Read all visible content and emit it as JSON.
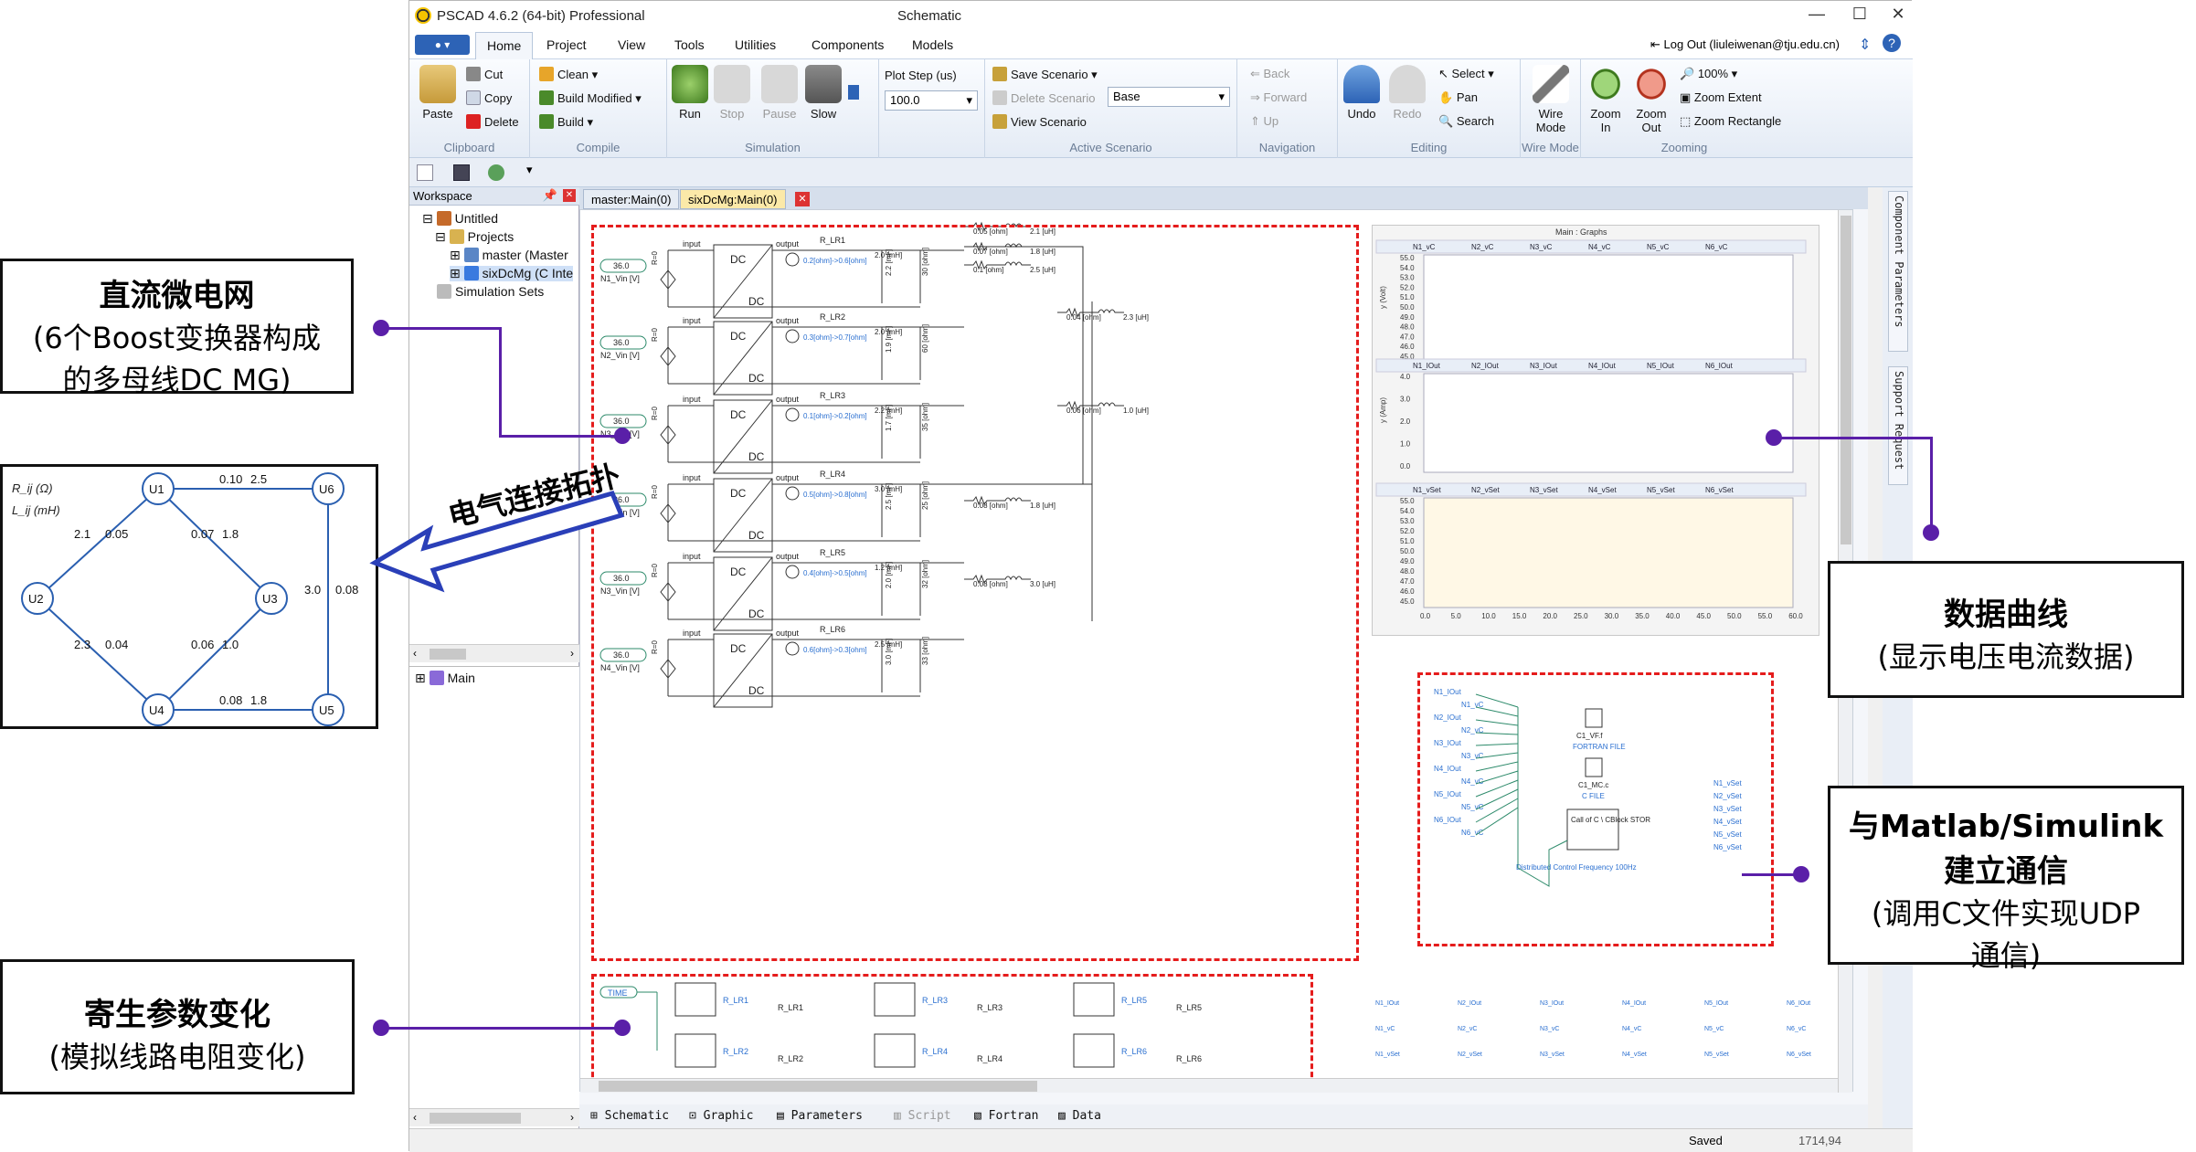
{
  "window": {
    "title": "PSCAD 4.6.2 (64-bit) Professional",
    "context": "Schematic",
    "logout": "Log Out (liuleiwenan@tju.edu.cn)",
    "controls": {
      "minimize": "—",
      "maximize": "☐",
      "close": "✕"
    }
  },
  "ribbon_tabs": [
    "Home",
    "Project",
    "View",
    "Tools",
    "Utilities",
    "Components",
    "Models"
  ],
  "ribbon": {
    "clipboard": {
      "paste": "Paste",
      "cut": "Cut",
      "copy": "Copy",
      "delete": "Delete",
      "label": "Clipboard"
    },
    "compile": {
      "clean": "Clean ▾",
      "build_modified": "Build Modified ▾",
      "build": "Build ▾",
      "label": "Compile"
    },
    "simulation": {
      "run": "Run",
      "stop": "Stop",
      "pause": "Pause",
      "slow": "Slow",
      "plot_step_label": "Plot Step (us)",
      "plot_step_value": "100.0",
      "label": "Simulation"
    },
    "scenario": {
      "save": "Save Scenario ▾",
      "delete": "Delete Scenario",
      "view": "View Scenario",
      "base": "Base",
      "label": "Active Scenario"
    },
    "navigation": {
      "back": "Back",
      "forward": "Forward",
      "up": "Up",
      "label": "Navigation"
    },
    "editing": {
      "undo": "Undo",
      "redo": "Redo",
      "select": "Select ▾",
      "pan": "Pan",
      "search": "Search",
      "label": "Editing"
    },
    "wire": {
      "wire_mode": "Wire Mode",
      "label": "Wire Mode"
    },
    "zooming": {
      "zoom_in": "Zoom In",
      "zoom_out": "Zoom Out",
      "zoom_pct": "100% ▾",
      "zoom_extent": "Zoom Extent",
      "zoom_rect": "Zoom Rectangle",
      "label": "Zooming"
    }
  },
  "workspace": {
    "title": "Workspace",
    "items": [
      "Untitled",
      "Projects",
      "master (Master",
      "sixDcMg (C Inte",
      "Simulation Sets"
    ],
    "bottom_item": "Main"
  },
  "doc_tabs": [
    "master:Main(0)",
    "sixDcMg:Main(0)"
  ],
  "bottom_tabs": [
    "Schematic",
    "Graphic",
    "Parameters",
    "Script",
    "Fortran",
    "Data"
  ],
  "status": {
    "left": "Saved",
    "right": "1714,94"
  },
  "side_tabs": [
    "Component Parameters",
    "Support Request"
  ],
  "schematic": {
    "converters": [
      {
        "src": "N1_Vin [V]",
        "lr": "R_LR1",
        "range": "0.2[ohm]->0.6[ohm]",
        "l": "2.0 [mH]",
        "c": "2.2 [mF]",
        "r": "30 [ohm]"
      },
      {
        "src": "N2_Vin [V]",
        "lr": "R_LR2",
        "range": "0.3[ohm]->0.7[ohm]",
        "l": "2.0 [mH]",
        "c": "1.9 [mF]",
        "r": "60 [ohm]"
      },
      {
        "src": "N3_Vin [V]",
        "lr": "R_LR3",
        "range": "0.1[ohm]->0.2[ohm]",
        "l": "2.2 [mH]",
        "c": "1.7 [mF]",
        "r": "35 [ohm]"
      },
      {
        "src": "N4_Vin [V]",
        "lr": "R_LR4",
        "range": "0.5[ohm]->0.8[ohm]",
        "l": "3.0 [mH]",
        "c": "2.5 [mF]",
        "r": "25 [ohm]"
      },
      {
        "src": "N3_Vin [V]",
        "lr": "R_LR5",
        "range": "0.4[ohm]->0.5[ohm]",
        "l": "1.2 [mH]",
        "c": "2.0 [mF]",
        "r": "32 [ohm]"
      },
      {
        "src": "N4_Vin [V]",
        "lr": "R_LR6",
        "range": "0.6[ohm]->0.3[ohm]",
        "l": "2.5 [mH]",
        "c": "3.0 [mF]",
        "r": "33 [ohm]"
      }
    ],
    "vin": "36.0",
    "rdrop": "R=0",
    "dc": "DC",
    "input": "input",
    "output": "output",
    "lines": [
      {
        "r": "0.05 [ohm]",
        "l": "2.1 [uH]"
      },
      {
        "r": "0.07 [ohm]",
        "l": "1.8 [uH]"
      },
      {
        "r": "0.1 [ohm]",
        "l": "2.5 [uH]"
      },
      {
        "r": "0.04 [ohm]",
        "l": "2.3 [uH]"
      },
      {
        "r": "0.06 [ohm]",
        "l": "1.0 [uH]"
      },
      {
        "r": "0.08 [ohm]",
        "l": "1.8 [uH]"
      },
      {
        "r": "0.08 [ohm]",
        "l": "3.0 [uH]"
      }
    ],
    "graphs": {
      "title": "Main : Graphs",
      "g1": {
        "series": [
          "N1_vC",
          "N2_vC",
          "N3_vC",
          "N4_vC",
          "N5_vC",
          "N6_vC"
        ],
        "ylabel": "y (Volt)",
        "ticks": [
          "55.0",
          "54.0",
          "53.0",
          "52.0",
          "51.0",
          "50.0",
          "49.0",
          "48.0",
          "47.0",
          "46.0",
          "45.0"
        ]
      },
      "g2": {
        "series": [
          "N1_IOut",
          "N2_IOut",
          "N3_IOut",
          "N4_IOut",
          "N5_IOut",
          "N6_IOut"
        ],
        "ylabel": "y (Amp)",
        "ticks": [
          "4.0",
          "3.0",
          "2.0",
          "1.0",
          "0.0"
        ]
      },
      "g3": {
        "series": [
          "N1_vSet",
          "N2_vSet",
          "N3_vSet",
          "N4_vSet",
          "N5_vSet",
          "N6_vSet"
        ],
        "ticks": [
          "55.0",
          "54.0",
          "53.0",
          "52.0",
          "51.0",
          "50.0",
          "49.0",
          "48.0",
          "47.0",
          "46.0",
          "45.0"
        ]
      },
      "xticks": [
        "0.0",
        "5.0",
        "10.0",
        "15.0",
        "20.0",
        "25.0",
        "30.0",
        "35.0",
        "40.0",
        "45.0",
        "50.0",
        "55.0",
        "60.0"
      ]
    },
    "comm": {
      "file1": "C1_VF.f",
      "file1_type": "FORTRAN FILE",
      "file2": "C1_MC.c",
      "file2_type": "C FILE",
      "block": "Call of C \\ CBlock STOR",
      "freq": "Distributed Control Frequency 100Hz",
      "inputs": [
        "N1_IOut",
        "N1_vC",
        "N2_IOut",
        "N2_vC",
        "N3_IOut",
        "N3_vC",
        "N4_IOut",
        "N4_vC",
        "N5_IOut",
        "N5_vC",
        "N6_IOut",
        "N6_vC"
      ],
      "outputs": [
        "N1_vSet",
        "N2_vSet",
        "N3_vSet",
        "N4_vSet",
        "N5_vSet",
        "N6_vSet"
      ]
    },
    "timeblock": {
      "time": "TIME",
      "rs": [
        "R_LR1",
        "R_LR2",
        "R_LR3",
        "R_LR4",
        "R_LR5",
        "R_LR6"
      ]
    }
  },
  "annotations": {
    "dcmg": {
      "title": "直流微电网",
      "sub1": "(6个Boost变换器构成",
      "sub2": "的多母线DC MG)"
    },
    "topology": {
      "arrow": "电气连接拓扑"
    },
    "curves": {
      "title": "数据曲线",
      "sub": "(显示电压电流数据)"
    },
    "matlab": {
      "title1": "与Matlab/Simulink",
      "title2": "建立通信",
      "sub1": "(调用C文件实现UDP",
      "sub2": "通信)"
    },
    "parasitic": {
      "title": "寄生参数变化",
      "sub": "(模拟线路电阻变化)"
    }
  },
  "topology": {
    "legend_r": "R_ij (Ω)",
    "legend_l": "L_ij (mH)",
    "nodes": [
      "U1",
      "U2",
      "U3",
      "U4",
      "U5",
      "U6"
    ],
    "edges": [
      {
        "r": "0.10",
        "l": "2.5"
      },
      {
        "r": "2.1",
        "l": "0.05"
      },
      {
        "r": "0.07",
        "l": "1.8"
      },
      {
        "r": "3.0",
        "l": "0.08"
      },
      {
        "r": "2.3",
        "l": "0.04"
      },
      {
        "r": "0.06",
        "l": "1.0"
      },
      {
        "r": "0.08",
        "l": "1.8"
      }
    ]
  },
  "colors": {
    "accent": "#5a1fa8",
    "dashed": "#e51c1c",
    "ribbon_blue": "#2d63b6",
    "node_blue": "#2a5fb0"
  }
}
